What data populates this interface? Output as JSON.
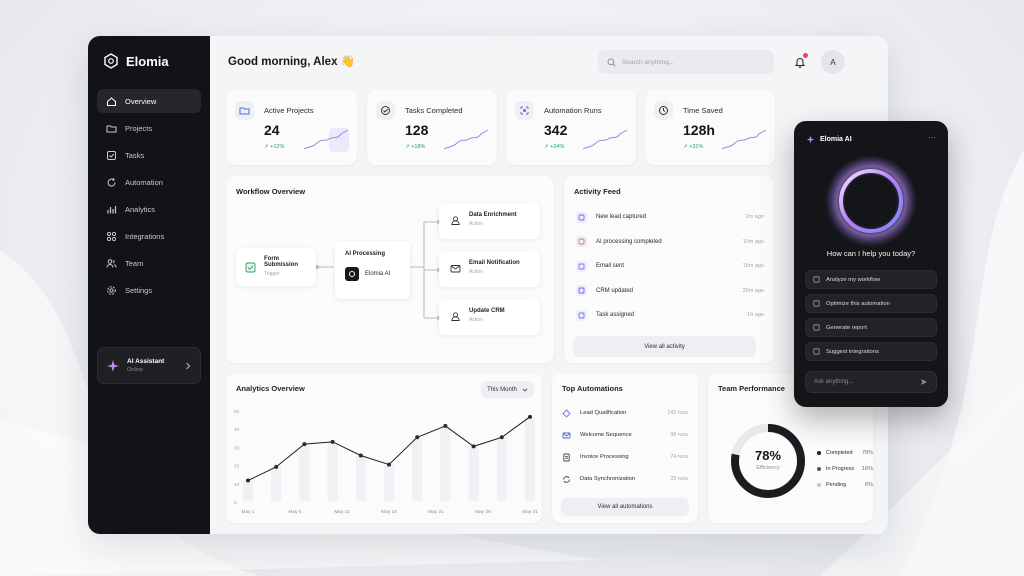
{
  "brand": {
    "name": "Elomia"
  },
  "sidebar": {
    "items": [
      {
        "label": "Overview",
        "icon": "home-icon",
        "active": true
      },
      {
        "label": "Projects",
        "icon": "folder-icon"
      },
      {
        "label": "Tasks",
        "icon": "check-square-icon"
      },
      {
        "label": "Automation",
        "icon": "refresh-icon"
      },
      {
        "label": "Analytics",
        "icon": "bar-chart-icon"
      },
      {
        "label": "Integrations",
        "icon": "grid-icon"
      },
      {
        "label": "Team",
        "icon": "users-icon"
      },
      {
        "label": "Settings",
        "icon": "gear-icon"
      }
    ],
    "assistant": {
      "title": "AI Assistant",
      "status": "Online"
    }
  },
  "header": {
    "greeting": "Good morning, Alex 👋",
    "search_placeholder": "Search anything...",
    "avatar_initial": "A"
  },
  "stats": [
    {
      "label": "Active Projects",
      "value": "24",
      "delta": "↗ +12%"
    },
    {
      "label": "Tasks Completed",
      "value": "128",
      "delta": "↗ +18%"
    },
    {
      "label": "Automation Runs",
      "value": "342",
      "delta": "↗ +24%"
    },
    {
      "label": "Time Saved",
      "value": "128h",
      "delta": "↗ +31%"
    }
  ],
  "workflow": {
    "title": "Workflow Overview",
    "trigger": {
      "title": "Form Submission",
      "sub": "Trigger"
    },
    "processing": {
      "title": "AI Processing",
      "engine": "Elomia AI"
    },
    "actions": [
      {
        "title": "Data Enrichment",
        "sub": "Action"
      },
      {
        "title": "Email Notification",
        "sub": "Action"
      },
      {
        "title": "Update CRM",
        "sub": "Action"
      }
    ]
  },
  "activity": {
    "title": "Activity Feed",
    "items": [
      {
        "text": "New lead captured",
        "time": "2m ago"
      },
      {
        "text": "AI processing completed",
        "time": "10m ago"
      },
      {
        "text": "Email sent",
        "time": "15m ago"
      },
      {
        "text": "CRM updated",
        "time": "25m ago"
      },
      {
        "text": "Task assigned",
        "time": "1h ago"
      }
    ],
    "view_all": "View all activity"
  },
  "analytics": {
    "title": "Analytics Overview",
    "period": "This Month"
  },
  "chart_data": {
    "type": "line",
    "x_labels": [
      "May 1",
      "May 6",
      "May 11",
      "May 16",
      "May 21",
      "May 26",
      "May 31"
    ],
    "y_ticks": [
      "0",
      "10",
      "20",
      "30",
      "40",
      "50"
    ],
    "values": [
      9,
      15,
      25,
      26,
      20,
      16,
      28,
      33,
      24,
      28,
      37
    ],
    "ylim": [
      0,
      40
    ],
    "line_color": "#1c1d21"
  },
  "automations": {
    "title": "Top Automations",
    "items": [
      {
        "name": "Lead Qualification",
        "runs": "142 runs"
      },
      {
        "name": "Welcome Sequence",
        "runs": "98 runs"
      },
      {
        "name": "Invoice Processing",
        "runs": "74 runs"
      },
      {
        "name": "Data Synchronization",
        "runs": "28 runs"
      }
    ],
    "view_all": "View all automations"
  },
  "team": {
    "title": "Team Performance",
    "value": "78%",
    "label": "Efficiency",
    "fraction": 0.78,
    "legend": [
      {
        "label": "Completed",
        "value": "78%",
        "color": "#1c1d21"
      },
      {
        "label": "In Progress",
        "value": "16%",
        "color": "#55575e"
      },
      {
        "label": "Pending",
        "value": "6%",
        "color": "#c4c6cc"
      }
    ]
  },
  "assistant_panel": {
    "title": "Elomia AI",
    "more": "···",
    "question": "How can I help you today?",
    "suggestions": [
      "Analyze my workflow",
      "Optimize this automation",
      "Generate report",
      "Suggest integrations"
    ],
    "input_placeholder": "Ask anything..."
  },
  "colors": {
    "accent": "#8b5cf6",
    "positive": "#23a36b",
    "dark": "#121316"
  }
}
